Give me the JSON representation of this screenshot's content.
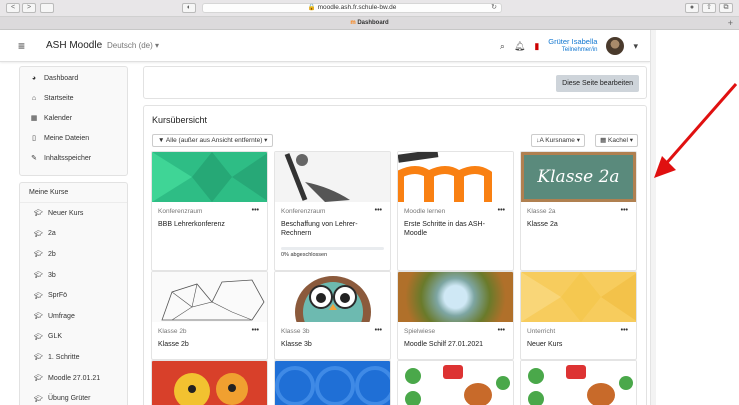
{
  "browser": {
    "url": "moodle.ash.fr.schule-bw.de",
    "tab_title": "Dashboard",
    "back": "<",
    "forward": ">"
  },
  "navbar": {
    "site_name": "ASH Moodle",
    "language": "Deutsch (de)",
    "user_name": "Grüter Isabella",
    "user_role": "Teilnehmer/in"
  },
  "sidebar": {
    "main_items": [
      {
        "label": "Dashboard",
        "icon": "dashboard-icon"
      },
      {
        "label": "Startseite",
        "icon": "home-icon"
      },
      {
        "label": "Kalender",
        "icon": "calendar-icon"
      },
      {
        "label": "Meine Dateien",
        "icon": "file-icon"
      },
      {
        "label": "Inhaltsspeicher",
        "icon": "paint-brush-icon"
      }
    ],
    "my_courses_title": "Meine Kurse",
    "courses": [
      "Neuer Kurs",
      "2a",
      "2b",
      "3b",
      "SprFö",
      "Umfrage",
      "GLK",
      "1. Schritte",
      "Moodle 27.01.21",
      "Übung Grüter"
    ]
  },
  "main": {
    "edit_button": "Diese Seite bearbeiten",
    "overview_title": "Kursübersicht",
    "filter": "Alle (außer aus Ansicht entfernte)",
    "sort": "Kursname",
    "view": "Kachel"
  },
  "courses": [
    {
      "category": "Konferenzraum",
      "name": "BBB Lehrerkonferenz",
      "progress": null
    },
    {
      "category": "Konferenzraum",
      "name": "Beschaffung von Lehrer-Rechnern",
      "progress": "0% abgeschlossen"
    },
    {
      "category": "Moodle lernen",
      "name": "Erste Schritte in das ASH-Moodle",
      "progress": null
    },
    {
      "category": "Klasse 2a",
      "name": "Klasse 2a",
      "progress": null
    },
    {
      "category": "Klasse 2b",
      "name": "Klasse 2b",
      "progress": null
    },
    {
      "category": "Klasse 3b",
      "name": "Klasse 3b",
      "progress": null
    },
    {
      "category": "Spielwiese",
      "name": "Moodle Schilf 27.01.2021",
      "progress": null
    },
    {
      "category": "Unterricht",
      "name": "Neuer Kurs",
      "progress": null
    }
  ],
  "chalkboard_text": "Klasse 2a",
  "colors": {
    "accent_link": "#1177d1",
    "arrow": "#e01010",
    "tile_green": "#2ebd85",
    "tile_yellow": "#f7cc5d",
    "tile_blue": "#1f6fd6"
  }
}
